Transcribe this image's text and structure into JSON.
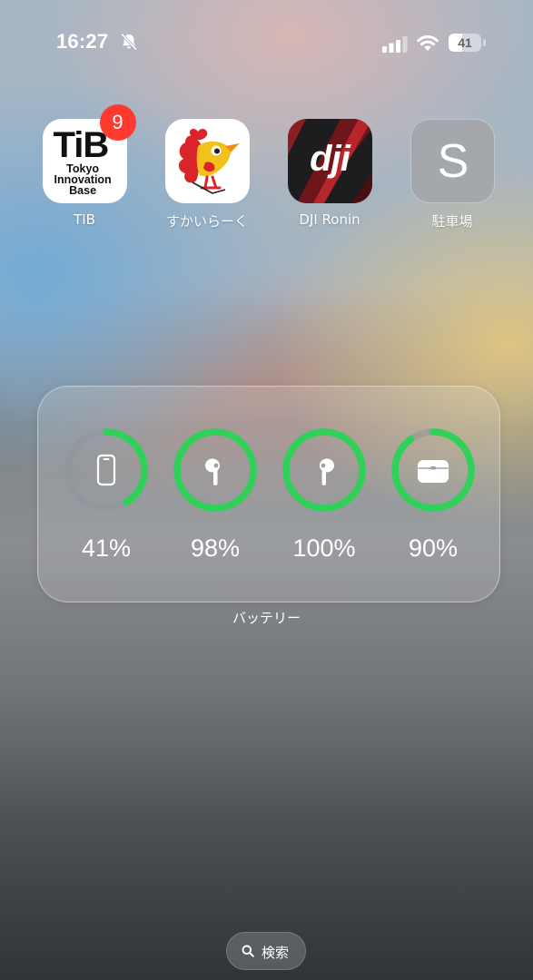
{
  "status_bar": {
    "time": "16:27",
    "battery_level": "41",
    "battery_fraction": 0.41,
    "icons": [
      "bell-slash-icon",
      "cellular-signal-icon",
      "wifi-icon",
      "battery-icon"
    ]
  },
  "apps": [
    {
      "label": "TIB",
      "badge": "9",
      "icon": "tib-app-icon",
      "logo_big": "TiB",
      "logo_lines": [
        "Tokyo",
        "Innovation",
        "Base"
      ]
    },
    {
      "label": "すかいらーく",
      "icon": "skylark-app-icon"
    },
    {
      "label": "DJI Ronin",
      "icon": "dji-ronin-app-icon",
      "logo": "dji"
    },
    {
      "label": "駐車場",
      "icon": "parking-app-icon",
      "logo": "S"
    }
  ],
  "battery_widget": {
    "title": "バッテリー",
    "accent_color": "#2fd158",
    "devices": [
      {
        "icon": "iphone-icon",
        "percent_label": "41%",
        "level": 0.41
      },
      {
        "icon": "airpod-left-icon",
        "percent_label": "98%",
        "level": 0.98
      },
      {
        "icon": "airpod-right-icon",
        "percent_label": "100%",
        "level": 1.0
      },
      {
        "icon": "airpods-case-icon",
        "percent_label": "90%",
        "level": 0.9
      }
    ]
  },
  "search": {
    "label": "検索",
    "icon": "search-icon"
  }
}
